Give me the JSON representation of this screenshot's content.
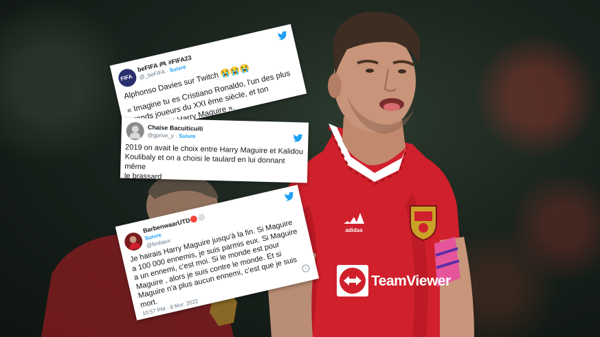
{
  "tweets": [
    {
      "name": "beFIFA 🎮 #FIFA23",
      "handle": "@_beFIFA",
      "follow": "Suivre",
      "avatar_text": "FIFA",
      "lines": [
        "Alphonso Davies sur Twitch 😭😭😭",
        "« Imagine tu es Cristiano Ronaldo, l'un des plus",
        "grands joueurs du XXI ème siècle, et ton",
        "capitaine est Harry Maguire »."
      ]
    },
    {
      "name": "Chaise Bacuiticuiti",
      "handle": "@gprive_y",
      "follow": "Suivre",
      "lines": [
        "2019 on avait le choix entre Harry Maguire et Kalidou",
        "Koulibaly et on a choisi le taulard en lui donnant même",
        "le brassard"
      ]
    },
    {
      "name": "BarbenwaarUTD🔴⚪",
      "handle": "@fimbaxx",
      "follow": "Suivre",
      "lines": [
        "Je hairais Harry Maguire jusqu'à la fin. Si Maguire",
        "a 100 000 ennemis, je suis parmis eux. Si Maguire",
        "a un ennemi, c'est moi. Si le monde est pour",
        "Maguire , alors je suis contre le monde. Et si",
        "Maguire n'a plus aucun ennemi, c'est que je suis",
        "mort."
      ],
      "timestamp": "10:57 PM · 8 févr. 2022"
    }
  ],
  "shirt": {
    "sponsor": "TeamViewer",
    "brand": "adidas"
  },
  "colors": {
    "twitter_blue": "#1da1f2",
    "jersey_red": "#d0202c",
    "armband_pink": "#e6559b"
  }
}
